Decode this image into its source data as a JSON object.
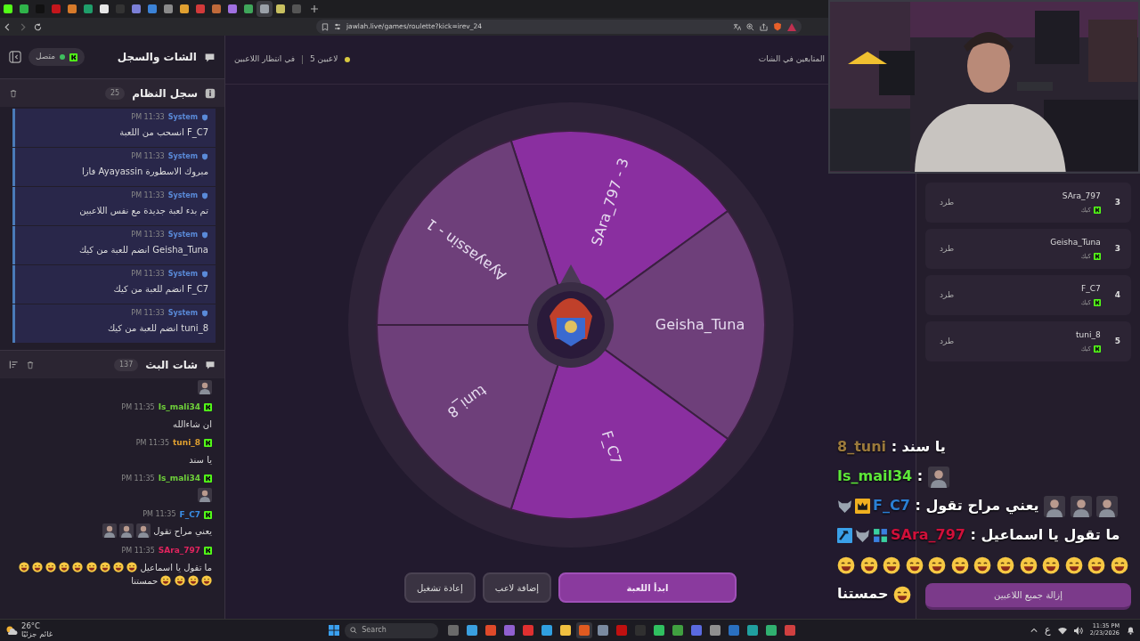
{
  "browser": {
    "tabs": [
      {
        "color": "#53fc18",
        "selected": false
      },
      {
        "color": "#2fb34a",
        "selected": false
      },
      {
        "color": "#111111",
        "selected": false
      },
      {
        "color": "#c4161c",
        "selected": false
      },
      {
        "color": "#d77a2a",
        "selected": false
      },
      {
        "color": "#1f9e6a",
        "selected": false
      },
      {
        "color": "#e6e6e6",
        "selected": false
      },
      {
        "color": "#333333",
        "selected": false
      },
      {
        "color": "#7b7fd6",
        "selected": false
      },
      {
        "color": "#3b82d6",
        "selected": false
      },
      {
        "color": "#8a8a8a",
        "selected": false
      },
      {
        "color": "#e0a030",
        "selected": false
      },
      {
        "color": "#d23a3a",
        "selected": false
      },
      {
        "color": "#c06a3a",
        "selected": false
      },
      {
        "color": "#a070e0",
        "selected": false
      },
      {
        "color": "#3fa65a",
        "selected": false
      },
      {
        "color": "#9aa0a8",
        "selected": true
      },
      {
        "color": "#c8c060",
        "selected": false
      },
      {
        "color": "#555555",
        "selected": false
      }
    ],
    "url": "jawlah.live/games/roulette?kick=irev_24"
  },
  "sidebar": {
    "title": "الشات والسجل",
    "status": "متصل",
    "connected": true,
    "system_log": {
      "title": "سجل النظام",
      "count": "25",
      "entries": [
        {
          "sender": "System",
          "time": "PM 11:33",
          "text": "F_C7 انسحب من اللعبة"
        },
        {
          "sender": "System",
          "time": "PM 11:33",
          "text": "مبروك الاسطورة Ayayassin فازا"
        },
        {
          "sender": "System",
          "time": "PM 11:33",
          "text": "تم بدء لعبة جديدة مع نفس اللاعبين"
        },
        {
          "sender": "System",
          "time": "PM 11:33",
          "text": "Geisha_Tuna انضم للعبة من كيك"
        },
        {
          "sender": "System",
          "time": "PM 11:33",
          "text": "F_C7 انضم للعبة من كيك"
        },
        {
          "sender": "System",
          "time": "PM 11:33",
          "text": "tuni_8 انضم للعبة من كيك"
        }
      ]
    },
    "stream_chat": {
      "title": "شات البث",
      "count": "137",
      "messages": [
        {
          "parts": [
            {
              "kind": "sticker"
            }
          ]
        },
        {
          "user": "Is_mali34",
          "color": "#6fd13a",
          "time": "PM 11:35",
          "parts": [
            {
              "kind": "text",
              "text": "ان شاءالله"
            }
          ]
        },
        {
          "user": "tuni_8",
          "color": "#e0a030",
          "time": "PM 11:35",
          "parts": [
            {
              "kind": "text",
              "text": "يا سند"
            }
          ]
        },
        {
          "user": "Is_mali34",
          "color": "#6fd13a",
          "time": "PM 11:35",
          "parts": [
            {
              "kind": "sticker"
            }
          ]
        },
        {
          "user": "F_C7",
          "color": "#3a8ee6",
          "time": "PM 11:35",
          "parts": [
            {
              "kind": "text",
              "text": "يعني مراح تقول"
            },
            {
              "kind": "sticker"
            },
            {
              "kind": "sticker"
            },
            {
              "kind": "sticker"
            }
          ]
        },
        {
          "user": "SAra_797",
          "color": "#e0245e",
          "time": "PM 11:35",
          "parts": [
            {
              "kind": "text",
              "text": "ما تقول يا اسماعيل"
            },
            {
              "kind": "emoji"
            },
            {
              "kind": "emoji"
            },
            {
              "kind": "emoji"
            },
            {
              "kind": "emoji"
            },
            {
              "kind": "emoji"
            },
            {
              "kind": "emoji"
            },
            {
              "kind": "emoji"
            },
            {
              "kind": "emoji"
            },
            {
              "kind": "emoji"
            },
            {
              "kind": "emoji"
            },
            {
              "kind": "emoji"
            },
            {
              "kind": "emoji"
            },
            {
              "kind": "emoji"
            },
            {
              "kind": "text",
              "text": "حمستنا"
            }
          ]
        }
      ]
    }
  },
  "game": {
    "status": "في انتظار اللاعبين",
    "players_count": "5 لاعبين",
    "followers_note": "المتابعين في الشات",
    "wheel": {
      "segments": [
        {
          "label": "SAra_797 - 3",
          "color": "#8a2fa0"
        },
        {
          "label": "Geisha_Tuna",
          "color": "#6e3f7a"
        },
        {
          "label": "F_C7",
          "color": "#8a2fa0"
        },
        {
          "label": "tuni_8",
          "color": "#6e3f7a"
        },
        {
          "label": "Ayayassin - 1",
          "color": "#6e3f7a"
        }
      ]
    },
    "buttons": [
      {
        "label": "ابدأ اللعبة",
        "kind": "primary"
      },
      {
        "label": "إضافة لاعب",
        "kind": "secondary"
      },
      {
        "label": "إعادة تشغيل",
        "kind": "secondary"
      }
    ]
  },
  "players": {
    "items": [
      {
        "rank": "3",
        "name": "SAra_797",
        "platform": "كيك",
        "action": "طرد"
      },
      {
        "rank": "3",
        "name": "Geisha_Tuna",
        "platform": "كيك",
        "action": "طرد"
      },
      {
        "rank": "4",
        "name": "F_C7",
        "platform": "كيك",
        "action": "طرد"
      },
      {
        "rank": "5",
        "name": "tuni_8",
        "platform": "كيك",
        "action": "طرد"
      }
    ],
    "clear_button": "إزالة جميع اللاعبين"
  },
  "overlay_chat": {
    "messages": [
      {
        "user": "8_tuni",
        "color": "#9c7a3c",
        "separator": ":",
        "parts": [
          {
            "kind": "text",
            "text": "يا سند"
          }
        ]
      },
      {
        "user": "Is_mail34",
        "color": "#5ee83a",
        "separator": ":",
        "parts": [
          {
            "kind": "sticker"
          }
        ]
      },
      {
        "user": "F_C7",
        "color": "#2a7fd4",
        "separator": ":",
        "badges": [
          {
            "kind": "wolf"
          },
          {
            "kind": "crown"
          }
        ],
        "parts": [
          {
            "kind": "text",
            "text": "يعني مراح تقول"
          },
          {
            "kind": "sticker"
          },
          {
            "kind": "sticker"
          },
          {
            "kind": "sticker"
          }
        ]
      },
      {
        "user": "SAra_797",
        "color": "#d0103a",
        "separator": ":",
        "badges": [
          {
            "kind": "hammer"
          },
          {
            "kind": "wolf"
          },
          {
            "kind": "gift"
          }
        ],
        "parts": [
          {
            "kind": "text",
            "text": "ما تقول يا اسماعيل"
          },
          {
            "kind": "emoji"
          },
          {
            "kind": "emoji"
          },
          {
            "kind": "emoji"
          },
          {
            "kind": "emoji"
          },
          {
            "kind": "emoji"
          },
          {
            "kind": "emoji"
          },
          {
            "kind": "emoji"
          },
          {
            "kind": "emoji"
          },
          {
            "kind": "emoji"
          },
          {
            "kind": "emoji"
          },
          {
            "kind": "emoji"
          },
          {
            "kind": "emoji"
          },
          {
            "kind": "emoji"
          },
          {
            "kind": "emoji"
          },
          {
            "kind": "text",
            "text": "حمستنا"
          }
        ]
      }
    ]
  },
  "taskbar": {
    "temperature": "26°C",
    "condition": "غائم جزئيًا",
    "search_placeholder": "Search",
    "apps": [
      {
        "color": "#6a6a6a",
        "selected": false
      },
      {
        "color": "#3aa0e0",
        "selected": false
      },
      {
        "color": "#e04a2a",
        "selected": false
      },
      {
        "color": "#9060d0",
        "selected": false
      },
      {
        "color": "#e03030",
        "selected": false
      },
      {
        "color": "#30a0e0",
        "selected": false
      },
      {
        "color": "#f0c040",
        "selected": false
      },
      {
        "color": "#e05a20",
        "selected": true
      },
      {
        "color": "#7a8aa0",
        "selected": false
      },
      {
        "color": "#c01010",
        "selected": false
      },
      {
        "color": "#303030",
        "selected": false
      },
      {
        "color": "#30c060",
        "selected": false
      },
      {
        "color": "#40a040",
        "selected": false
      },
      {
        "color": "#5a6ae0",
        "selected": false
      },
      {
        "color": "#909090",
        "selected": false
      },
      {
        "color": "#2a70c0",
        "selected": false
      },
      {
        "color": "#20a0a0",
        "selected": false
      },
      {
        "color": "#30b070",
        "selected": false
      },
      {
        "color": "#d04040",
        "selected": false
      }
    ],
    "keyboard": "ع",
    "time": "11:35 PM",
    "date": "2/23/2026"
  }
}
